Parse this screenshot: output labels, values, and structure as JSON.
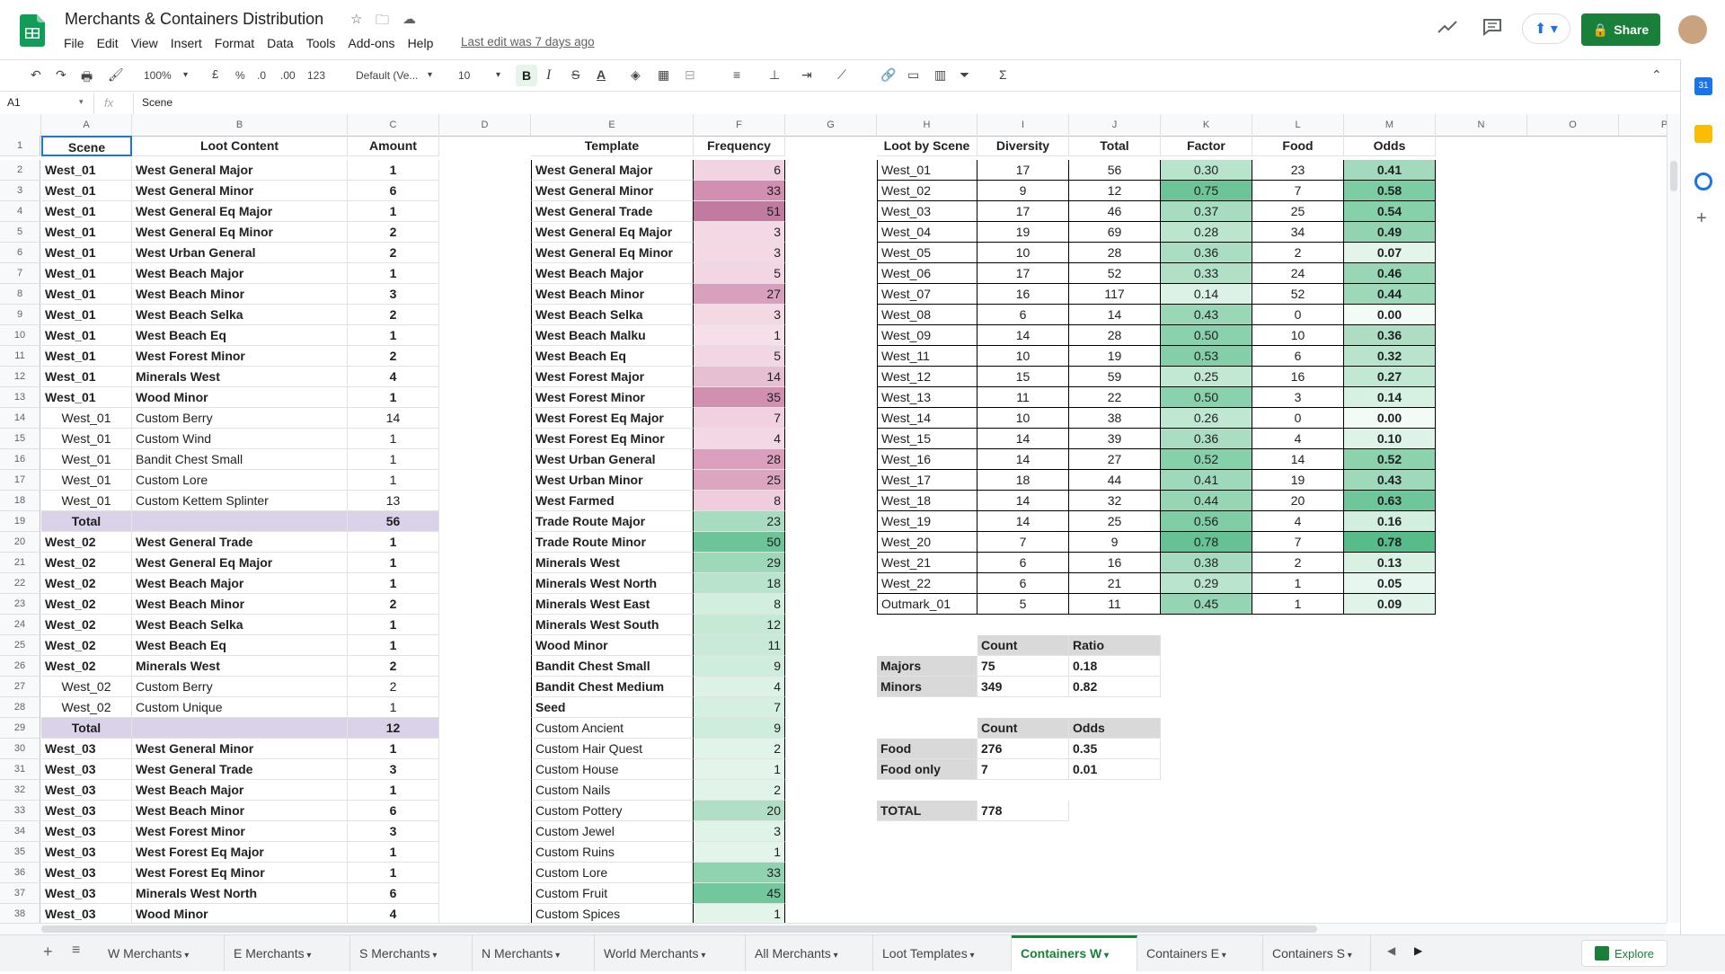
{
  "app": {
    "title": "Merchants & Containers Distribution",
    "menus": [
      "File",
      "Edit",
      "View",
      "Insert",
      "Format",
      "Data",
      "Tools",
      "Add-ons",
      "Help"
    ],
    "last_edit": "Last edit was 7 days ago",
    "share_label": "Share",
    "brand_color": "#188038"
  },
  "toolbar": {
    "zoom": "100%",
    "currency": "£",
    "percent": "%",
    "dec_less": ".0",
    "dec_more": ".00",
    "format_more": "123",
    "font": "Default (Ve...",
    "font_size": "10"
  },
  "formula_bar": {
    "cell_ref": "A1",
    "fx": "fx",
    "value": "Scene"
  },
  "columns": {
    "letters": [
      "A",
      "B",
      "C",
      "D",
      "E",
      "F",
      "G",
      "H",
      "I",
      "J",
      "K",
      "L",
      "M",
      "N",
      "O",
      "P"
    ]
  },
  "headers": {
    "scene": "Scene",
    "loot_content": "Loot Content",
    "amount": "Amount",
    "template": "Template",
    "frequency": "Frequency",
    "loot_by_scene": "Loot by Scene",
    "diversity": "Diversity",
    "total": "Total",
    "factor": "Factor",
    "food": "Food",
    "odds": "Odds"
  },
  "loot_rows": [
    {
      "scene": "West_01",
      "content": "West General Major",
      "amount": "1",
      "bold": true
    },
    {
      "scene": "West_01",
      "content": "West General Minor",
      "amount": "6",
      "bold": true
    },
    {
      "scene": "West_01",
      "content": "West General Eq Major",
      "amount": "1",
      "bold": true
    },
    {
      "scene": "West_01",
      "content": "West General Eq Minor",
      "amount": "2",
      "bold": true
    },
    {
      "scene": "West_01",
      "content": "West Urban General",
      "amount": "2",
      "bold": true
    },
    {
      "scene": "West_01",
      "content": "West Beach Major",
      "amount": "1",
      "bold": true
    },
    {
      "scene": "West_01",
      "content": "West Beach Minor",
      "amount": "3",
      "bold": true
    },
    {
      "scene": "West_01",
      "content": "West Beach Selka",
      "amount": "2",
      "bold": true
    },
    {
      "scene": "West_01",
      "content": "West Beach Eq",
      "amount": "1",
      "bold": true
    },
    {
      "scene": "West_01",
      "content": "West Forest Minor",
      "amount": "2",
      "bold": true
    },
    {
      "scene": "West_01",
      "content": "Minerals West",
      "amount": "4",
      "bold": true
    },
    {
      "scene": "West_01",
      "content": "Wood Minor",
      "amount": "1",
      "bold": true
    },
    {
      "scene": "West_01",
      "content": "Custom Berry",
      "amount": "14",
      "bold": false
    },
    {
      "scene": "West_01",
      "content": "Custom Wind",
      "amount": "1",
      "bold": false
    },
    {
      "scene": "West_01",
      "content": "Bandit Chest Small",
      "amount": "1",
      "bold": false
    },
    {
      "scene": "West_01",
      "content": "Custom Lore",
      "amount": "1",
      "bold": false
    },
    {
      "scene": "West_01",
      "content": "Custom Kettem Splinter",
      "amount": "13",
      "bold": false
    },
    {
      "scene": "Total",
      "content": "",
      "amount": "56",
      "bold": true,
      "total": true
    },
    {
      "scene": "West_02",
      "content": "West General Trade",
      "amount": "1",
      "bold": true
    },
    {
      "scene": "West_02",
      "content": "West General Eq Major",
      "amount": "1",
      "bold": true
    },
    {
      "scene": "West_02",
      "content": "West Beach Major",
      "amount": "1",
      "bold": true
    },
    {
      "scene": "West_02",
      "content": "West Beach Minor",
      "amount": "2",
      "bold": true
    },
    {
      "scene": "West_02",
      "content": "West Beach Selka",
      "amount": "1",
      "bold": true
    },
    {
      "scene": "West_02",
      "content": "West Beach Eq",
      "amount": "1",
      "bold": true
    },
    {
      "scene": "West_02",
      "content": "Minerals West",
      "amount": "2",
      "bold": true
    },
    {
      "scene": "West_02",
      "content": "Custom Berry",
      "amount": "2",
      "bold": false
    },
    {
      "scene": "West_02",
      "content": "Custom Unique",
      "amount": "1",
      "bold": false
    },
    {
      "scene": "Total",
      "content": "",
      "amount": "12",
      "bold": true,
      "total": true
    },
    {
      "scene": "West_03",
      "content": "West General Minor",
      "amount": "1",
      "bold": true
    },
    {
      "scene": "West_03",
      "content": "West General Trade",
      "amount": "3",
      "bold": true
    },
    {
      "scene": "West_03",
      "content": "West Beach Major",
      "amount": "1",
      "bold": true
    },
    {
      "scene": "West_03",
      "content": "West Beach Minor",
      "amount": "6",
      "bold": true
    },
    {
      "scene": "West_03",
      "content": "West Forest Minor",
      "amount": "3",
      "bold": true
    },
    {
      "scene": "West_03",
      "content": "West Forest Eq Major",
      "amount": "1",
      "bold": true
    },
    {
      "scene": "West_03",
      "content": "West Forest Eq Minor",
      "amount": "1",
      "bold": true
    },
    {
      "scene": "West_03",
      "content": "Minerals West North",
      "amount": "6",
      "bold": true
    },
    {
      "scene": "West_03",
      "content": "Wood Minor",
      "amount": "4",
      "bold": true
    }
  ],
  "templates": [
    {
      "name": "West General Major",
      "freq": "6",
      "bold": true,
      "color": "#f2d3e1"
    },
    {
      "name": "West General Minor",
      "freq": "33",
      "bold": true,
      "color": "#d38fb1"
    },
    {
      "name": "West General Trade",
      "freq": "51",
      "bold": true,
      "color": "#c27ba0"
    },
    {
      "name": "West General Eq Major",
      "freq": "3",
      "bold": true,
      "color": "#f4d9e5"
    },
    {
      "name": "West General Eq Minor",
      "freq": "3",
      "bold": true,
      "color": "#f4d9e5"
    },
    {
      "name": "West Beach Major",
      "freq": "5",
      "bold": true,
      "color": "#f3d6e3"
    },
    {
      "name": "West Beach Minor",
      "freq": "27",
      "bold": true,
      "color": "#d9a0bd"
    },
    {
      "name": "West Beach Selka",
      "freq": "3",
      "bold": true,
      "color": "#f4d9e5"
    },
    {
      "name": "West Beach Malku",
      "freq": "1",
      "bold": true,
      "color": "#f6dfe9"
    },
    {
      "name": "West Beach Eq",
      "freq": "5",
      "bold": true,
      "color": "#f3d6e3"
    },
    {
      "name": "West Forest Major",
      "freq": "14",
      "bold": true,
      "color": "#e6bfd2"
    },
    {
      "name": "West Forest Minor",
      "freq": "35",
      "bold": true,
      "color": "#d190b0"
    },
    {
      "name": "West Forest Eq Major",
      "freq": "7",
      "bold": true,
      "color": "#f1d0df"
    },
    {
      "name": "West Forest Eq Minor",
      "freq": "4",
      "bold": true,
      "color": "#f3d7e4"
    },
    {
      "name": "West Urban General",
      "freq": "28",
      "bold": true,
      "color": "#d99fbc"
    },
    {
      "name": "West Urban Minor",
      "freq": "25",
      "bold": true,
      "color": "#dca6c1"
    },
    {
      "name": "West Farmed",
      "freq": "8",
      "bold": true,
      "color": "#f0cddd"
    },
    {
      "name": "Trade Route Major",
      "freq": "23",
      "bold": true,
      "color": "#a8dcc1"
    },
    {
      "name": "Trade Route Minor",
      "freq": "50",
      "bold": true,
      "color": "#6cc498"
    },
    {
      "name": "Minerals West",
      "freq": "29",
      "bold": true,
      "color": "#9dd8b9"
    },
    {
      "name": "Minerals West North",
      "freq": "18",
      "bold": true,
      "color": "#b8e3cc"
    },
    {
      "name": "Minerals West East",
      "freq": "8",
      "bold": true,
      "color": "#d2eedf"
    },
    {
      "name": "Minerals West South",
      "freq": "12",
      "bold": true,
      "color": "#c6e9d6"
    },
    {
      "name": "Wood Minor",
      "freq": "11",
      "bold": true,
      "color": "#c9ead8"
    },
    {
      "name": "Bandit Chest Small",
      "freq": "9",
      "bold": true,
      "color": "#cfeddd"
    },
    {
      "name": "Bandit Chest Medium",
      "freq": "4",
      "bold": true,
      "color": "#dcf2e6"
    },
    {
      "name": "Seed",
      "freq": "7",
      "bold": true,
      "color": "#d5efe1"
    },
    {
      "name": "Custom Ancient",
      "freq": "9",
      "bold": false,
      "color": "#cfeddd"
    },
    {
      "name": "Custom Hair Quest",
      "freq": "2",
      "bold": false,
      "color": "#e1f4ea"
    },
    {
      "name": "Custom House",
      "freq": "1",
      "bold": false,
      "color": "#e3f5eb"
    },
    {
      "name": "Custom Nails",
      "freq": "2",
      "bold": false,
      "color": "#e1f4ea"
    },
    {
      "name": "Custom Pottery",
      "freq": "20",
      "bold": false,
      "color": "#b0dfc6"
    },
    {
      "name": "Custom Jewel",
      "freq": "3",
      "bold": false,
      "color": "#dff3e8"
    },
    {
      "name": "Custom Ruins",
      "freq": "1",
      "bold": false,
      "color": "#e3f5eb"
    },
    {
      "name": "Custom Lore",
      "freq": "33",
      "bold": false,
      "color": "#8fd3b0"
    },
    {
      "name": "Custom Fruit",
      "freq": "45",
      "bold": false,
      "color": "#73c79d"
    },
    {
      "name": "Custom Spices",
      "freq": "1",
      "bold": false,
      "color": "#e3f5eb"
    }
  ],
  "scene_stats": [
    {
      "scene": "West_01",
      "diversity": "17",
      "total": "56",
      "factor": "0.30",
      "factor_color": "#b8e3cc",
      "food": "23",
      "odds": "0.41",
      "odds_color": "#a3dabe"
    },
    {
      "scene": "West_02",
      "diversity": "9",
      "total": "12",
      "factor": "0.75",
      "factor_color": "#6cc498",
      "food": "7",
      "odds": "0.58",
      "odds_color": "#7ccda4"
    },
    {
      "scene": "West_03",
      "diversity": "17",
      "total": "46",
      "factor": "0.37",
      "factor_color": "#a8dcc1",
      "food": "25",
      "odds": "0.54",
      "odds_color": "#86d0aa"
    },
    {
      "scene": "West_04",
      "diversity": "19",
      "total": "69",
      "factor": "0.28",
      "factor_color": "#bce5ce",
      "food": "34",
      "odds": "0.49",
      "odds_color": "#92d4b2"
    },
    {
      "scene": "West_05",
      "diversity": "10",
      "total": "28",
      "factor": "0.36",
      "factor_color": "#aaddc2",
      "food": "2",
      "odds": "0.07",
      "odds_color": "#e3f5eb"
    },
    {
      "scene": "West_06",
      "diversity": "17",
      "total": "52",
      "factor": "0.33",
      "factor_color": "#b1e0c7",
      "food": "24",
      "odds": "0.46",
      "odds_color": "#98d6b6"
    },
    {
      "scene": "West_07",
      "diversity": "16",
      "total": "117",
      "factor": "0.14",
      "factor_color": "#dcf2e6",
      "food": "52",
      "odds": "0.44",
      "odds_color": "#9dd8b9"
    },
    {
      "scene": "West_08",
      "diversity": "6",
      "total": "14",
      "factor": "0.43",
      "factor_color": "#9ad7b7",
      "food": "0",
      "odds": "0.00",
      "odds_color": "#f3fbf7"
    },
    {
      "scene": "West_09",
      "diversity": "14",
      "total": "28",
      "factor": "0.50",
      "factor_color": "#8ad1ad",
      "food": "10",
      "odds": "0.36",
      "odds_color": "#aeddc4"
    },
    {
      "scene": "West_11",
      "diversity": "10",
      "total": "19",
      "factor": "0.53",
      "factor_color": "#84cfa9",
      "food": "6",
      "odds": "0.32",
      "odds_color": "#b8e3cc"
    },
    {
      "scene": "West_12",
      "diversity": "15",
      "total": "59",
      "factor": "0.25",
      "factor_color": "#c2e8d3",
      "food": "16",
      "odds": "0.27",
      "odds_color": "#c2e8d3"
    },
    {
      "scene": "West_13",
      "diversity": "11",
      "total": "22",
      "factor": "0.50",
      "factor_color": "#8ad1ad",
      "food": "3",
      "odds": "0.14",
      "odds_color": "#d6f0e2"
    },
    {
      "scene": "West_14",
      "diversity": "10",
      "total": "38",
      "factor": "0.26",
      "factor_color": "#c0e7d2",
      "food": "0",
      "odds": "0.00",
      "odds_color": "#f3fbf7"
    },
    {
      "scene": "West_15",
      "diversity": "14",
      "total": "39",
      "factor": "0.36",
      "factor_color": "#aaddc2",
      "food": "4",
      "odds": "0.10",
      "odds_color": "#def3e8"
    },
    {
      "scene": "West_16",
      "diversity": "14",
      "total": "27",
      "factor": "0.52",
      "factor_color": "#86d0aa",
      "food": "14",
      "odds": "0.52",
      "odds_color": "#8bd2ad"
    },
    {
      "scene": "West_17",
      "diversity": "18",
      "total": "44",
      "factor": "0.41",
      "factor_color": "#9fd9bb",
      "food": "19",
      "odds": "0.43",
      "odds_color": "#9fd9bb"
    },
    {
      "scene": "West_18",
      "diversity": "14",
      "total": "32",
      "factor": "0.44",
      "factor_color": "#97d6b5",
      "food": "20",
      "odds": "0.63",
      "odds_color": "#6fc69b"
    },
    {
      "scene": "West_19",
      "diversity": "14",
      "total": "25",
      "factor": "0.56",
      "factor_color": "#7ecda5",
      "food": "4",
      "odds": "0.16",
      "odds_color": "#d2eedf"
    },
    {
      "scene": "West_20",
      "diversity": "7",
      "total": "9",
      "factor": "0.78",
      "factor_color": "#66c294",
      "food": "7",
      "odds": "0.78",
      "odds_color": "#57bb8a"
    },
    {
      "scene": "West_21",
      "diversity": "6",
      "total": "16",
      "factor": "0.38",
      "factor_color": "#a6dbbf",
      "food": "2",
      "odds": "0.13",
      "odds_color": "#d8f1e3"
    },
    {
      "scene": "West_22",
      "diversity": "6",
      "total": "21",
      "factor": "0.29",
      "factor_color": "#bae4cd",
      "food": "1",
      "odds": "0.05",
      "odds_color": "#e7f6ee"
    },
    {
      "scene": "Outmark_01",
      "diversity": "5",
      "total": "11",
      "factor": "0.45",
      "factor_color": "#95d5b4",
      "food": "1",
      "odds": "0.09",
      "odds_color": "#e0f4e9"
    }
  ],
  "summary": {
    "count": "Count",
    "ratio": "Ratio",
    "odds": "Odds",
    "majors_label": "Majors",
    "majors_count": "75",
    "majors_ratio": "0.18",
    "minors_label": "Minors",
    "minors_count": "349",
    "minors_ratio": "0.82",
    "food_label": "Food",
    "food_count": "276",
    "food_odds": "0.35",
    "foodonly_label": "Food only",
    "foodonly_count": "7",
    "foodonly_odds": "0.01",
    "total_label": "TOTAL",
    "total_count": "778"
  },
  "tabs": [
    "W Merchants",
    "E Merchants",
    "S Merchants",
    "N Merchants",
    "World Merchants",
    "All Merchants",
    "Loot Templates",
    "Containers W",
    "Containers E",
    "Containers S"
  ],
  "active_tab": "Containers W",
  "explore_label": "Explore"
}
